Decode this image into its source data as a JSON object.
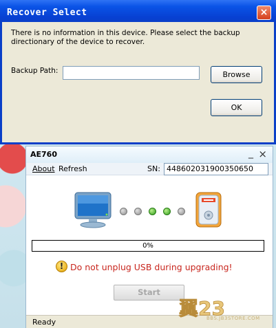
{
  "recover": {
    "title": "Recover Select",
    "close": "×",
    "info": "There is no information in this device. Please select the backup directionary of the device to recover.",
    "path_label": "Backup Path:",
    "path_value": "",
    "browse_label": "Browse",
    "ok_label": "OK"
  },
  "app": {
    "title": "AE760",
    "minimize": "_",
    "close": "×",
    "menu": {
      "about": "About",
      "refresh": "Refresh"
    },
    "sn_label": "SN:",
    "sn_value": "448602031900350650",
    "progress": 0,
    "progress_text": "0%",
    "dots": [
      "grey",
      "grey",
      "green",
      "green",
      "grey"
    ],
    "warning_icon": "!",
    "warning": "Do not unplug USB during upgrading!",
    "start_label": "Start",
    "status": "Ready",
    "colors": {
      "warning": "#c8261e",
      "accent": "#0a53e6",
      "device": "#f0a030"
    }
  },
  "watermark": {
    "text": "翼23",
    "sub": "BBS.JB3STORE.COM"
  }
}
